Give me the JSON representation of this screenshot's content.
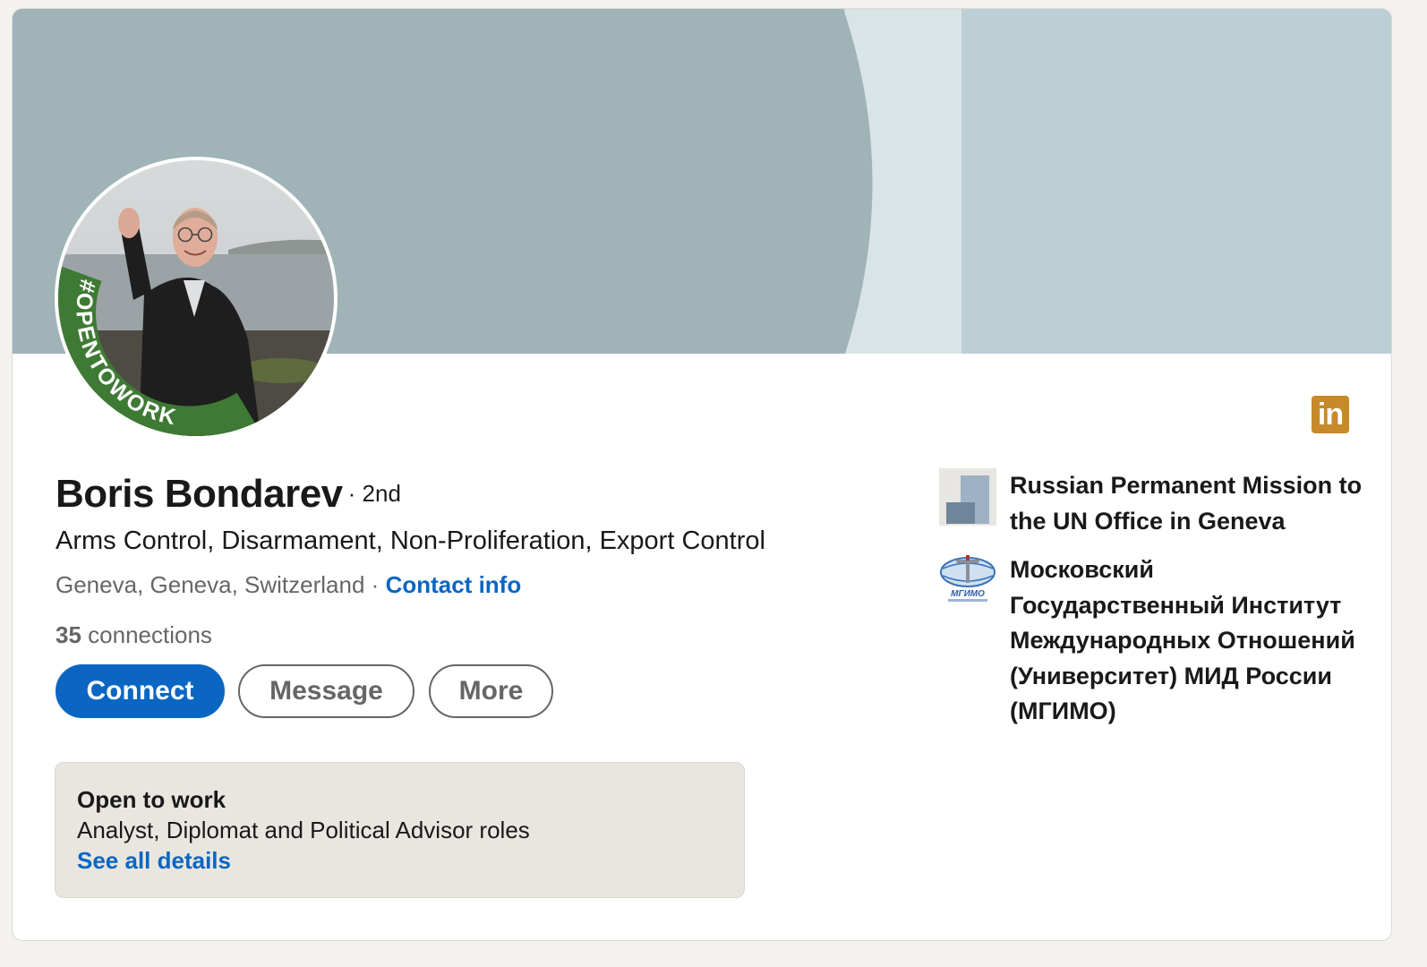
{
  "profile": {
    "name": "Boris Bondarev",
    "degree": "· 2nd",
    "headline": "Arms Control, Disarmament, Non-Proliferation, Export Control",
    "location": "Geneva, Geneva, Switzerland",
    "separator": "·",
    "contact_info_label": "Contact info",
    "connections_count": "35",
    "connections_label": "connections",
    "photo_frame_text": "#OPENTOWORK"
  },
  "actions": {
    "connect_label": "Connect",
    "message_label": "Message",
    "more_label": "More"
  },
  "open_to_work": {
    "title": "Open to work",
    "roles": "Analyst, Diplomat and Political Advisor roles",
    "link_label": "See all details"
  },
  "organizations": [
    {
      "name": "Russian Permanent Mission to the UN Office in Geneva",
      "icon": "building-icon"
    },
    {
      "name": "Московский Государственный Институт Международных Отношений (Университет) МИД России (МГИМО)",
      "icon": "mgimo-logo",
      "logo_text": "МГИМО"
    }
  ],
  "brand": {
    "logo_text": "in"
  },
  "colors": {
    "accent": "#0a66c2",
    "open_to_work_green": "#3e7a34",
    "banner": "#a0b3b7",
    "linkedin_badge": "#c7892a"
  }
}
